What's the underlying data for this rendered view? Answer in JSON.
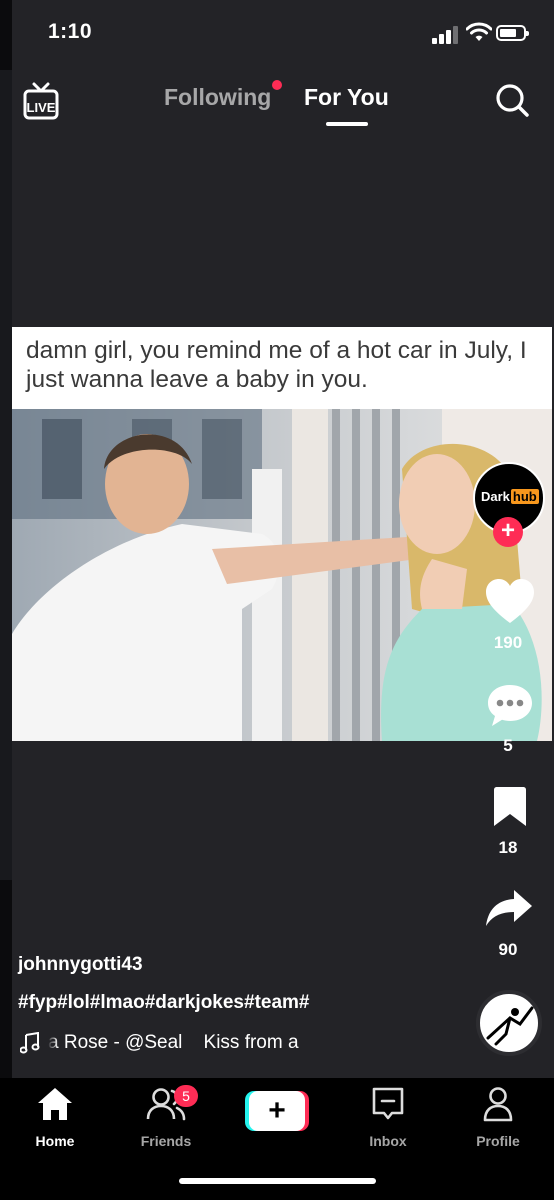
{
  "status_bar": {
    "time": "1:10"
  },
  "top_nav": {
    "live_label": "LIVE",
    "tabs": [
      {
        "label": "Following",
        "has_dot": true
      },
      {
        "label": "For You",
        "active": true
      }
    ]
  },
  "post": {
    "meme_text": "damn girl, you remind me of a hot car in July, I just wanna leave a baby in you.",
    "creator_logo": {
      "part1": "Dark",
      "part2": "hub"
    },
    "likes": "190",
    "comments": "5",
    "saves": "18",
    "shares": "90",
    "username": "johnnygotti43",
    "hashtags": "#fyp#lol#lmao#darkjokes#team#",
    "music": "a Rose - @Seal    Kiss from a"
  },
  "bottom_nav": {
    "items": [
      {
        "label": "Home",
        "icon": "home-icon",
        "active": true
      },
      {
        "label": "Friends",
        "icon": "friends-icon",
        "badge": "5"
      },
      {
        "label": "",
        "icon": "plus-icon"
      },
      {
        "label": "Inbox",
        "icon": "inbox-icon"
      },
      {
        "label": "Profile",
        "icon": "profile-icon"
      }
    ]
  },
  "colors": {
    "accent": "#fe2c55",
    "cyan": "#25f4ee",
    "background": "#232327"
  }
}
